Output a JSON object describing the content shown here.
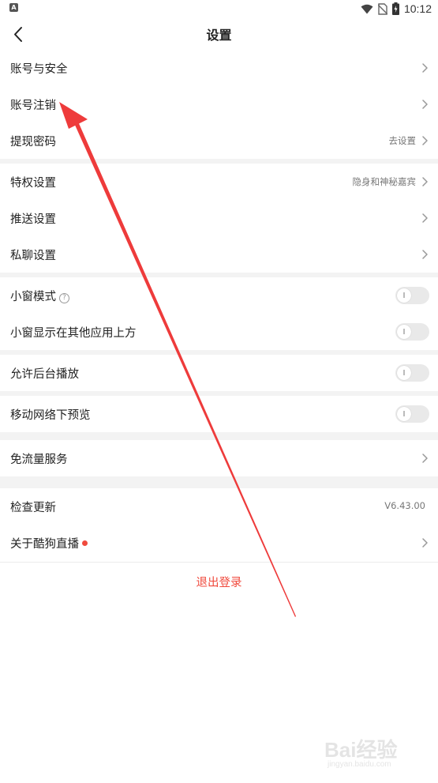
{
  "status_bar": {
    "app_icon_letter": "A",
    "time": "10:12",
    "icons": [
      "wifi-icon",
      "no-sim-icon",
      "battery-charging-icon"
    ]
  },
  "nav": {
    "title": "设置",
    "back_icon": "chevron-left-icon"
  },
  "groups": [
    {
      "items": [
        {
          "label": "账号与安全",
          "value": "",
          "control": "chevron"
        },
        {
          "label": "账号注销",
          "value": "",
          "control": "chevron"
        },
        {
          "label": "提现密码",
          "value": "去设置",
          "control": "chevron"
        }
      ]
    },
    {
      "items": [
        {
          "label": "特权设置",
          "value": "隐身和神秘嘉宾",
          "control": "chevron"
        },
        {
          "label": "推送设置",
          "value": "",
          "control": "chevron"
        },
        {
          "label": "私聊设置",
          "value": "",
          "control": "chevron"
        }
      ]
    },
    {
      "items": [
        {
          "label": "小窗模式",
          "help_icon": "?",
          "control": "toggle",
          "on": false
        },
        {
          "label": "小窗显示在其他应用上方",
          "control": "toggle",
          "on": false
        }
      ]
    },
    {
      "items": [
        {
          "label": "允许后台播放",
          "control": "toggle",
          "on": false
        }
      ]
    },
    {
      "items": [
        {
          "label": "移动网络下预览",
          "control": "toggle",
          "on": false
        }
      ]
    },
    {
      "items": [
        {
          "label": "免流量服务",
          "value": "",
          "control": "chevron"
        }
      ]
    },
    {
      "items": [
        {
          "label": "检查更新",
          "value": "V6.43.00",
          "control": "none"
        },
        {
          "label": "关于酷狗直播",
          "value": "",
          "control": "chevron",
          "badge": "red-dot"
        }
      ]
    }
  ],
  "logout_label": "退出登录",
  "colors": {
    "accent_red": "#f04a3d",
    "annotation_arrow": "#ee3b3b",
    "section_gap": "#f3f3f3",
    "toggle_off": "#e9e9e9"
  },
  "watermark": {
    "brand": "Bai经验",
    "url": "jingyan.baidu.com"
  }
}
